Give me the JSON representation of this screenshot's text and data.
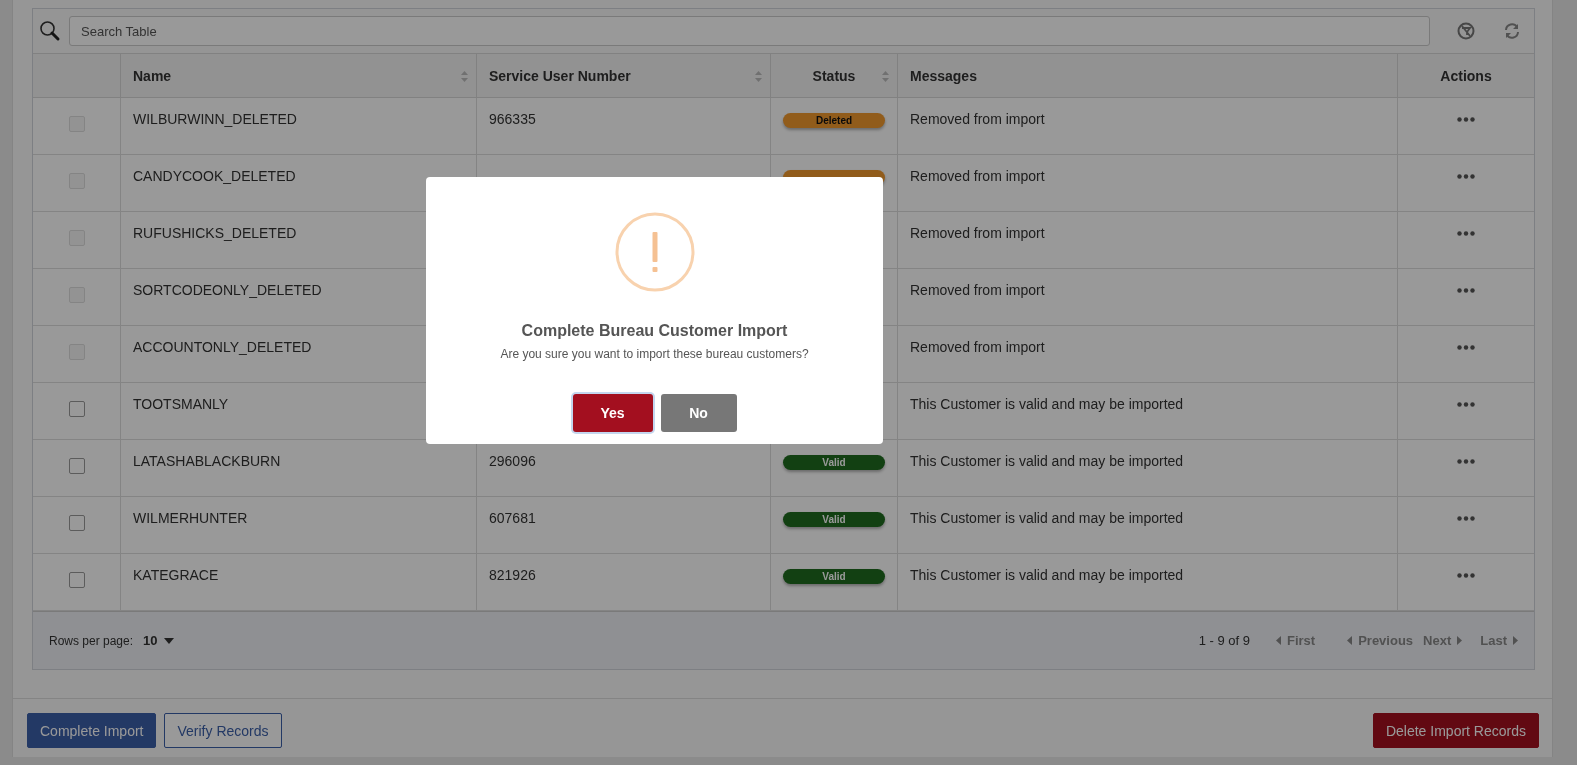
{
  "search": {
    "placeholder": "Search Table"
  },
  "table": {
    "columns": [
      {
        "label": "Name",
        "sortable": true
      },
      {
        "label": "Service User Number",
        "sortable": true
      },
      {
        "label": "Status",
        "sortable": true
      },
      {
        "label": "Messages",
        "sortable": false
      },
      {
        "label": "Actions",
        "sortable": false
      }
    ],
    "rows": [
      {
        "name": "WILBURWINN_DELETED",
        "number": "966335",
        "status": {
          "label": "Deleted",
          "kind": "deleted"
        },
        "message": "Removed from import",
        "checked": false,
        "disabled": true
      },
      {
        "name": "CANDYCOOK_DELETED",
        "status": {
          "kind": "deleted"
        },
        "message": "Removed from import",
        "checked": false,
        "disabled": true
      },
      {
        "name": "RUFUSHICKS_DELETED",
        "message": "Removed from import",
        "checked": false,
        "disabled": true
      },
      {
        "name": "SORTCODEONLY_DELETED",
        "message": "Removed from import",
        "checked": false,
        "disabled": true
      },
      {
        "name": "ACCOUNTONLY_DELETED",
        "message": "Removed from import",
        "checked": false,
        "disabled": true
      },
      {
        "name": "TOOTSMANLY",
        "message": "This Customer is valid and may be imported",
        "checked": false,
        "disabled": false
      },
      {
        "name": "LATASHABLACKBURN",
        "number": "296096",
        "status": {
          "label": "Valid",
          "kind": "valid"
        },
        "message": "This Customer is valid and may be imported",
        "checked": false,
        "disabled": false
      },
      {
        "name": "WILMERHUNTER",
        "number": "607681",
        "status": {
          "label": "Valid",
          "kind": "valid"
        },
        "message": "This Customer is valid and may be imported",
        "checked": false,
        "disabled": false
      },
      {
        "name": "KATEGRACE",
        "number": "821926",
        "status": {
          "label": "Valid",
          "kind": "valid"
        },
        "message": "This Customer is valid and may be imported",
        "checked": false,
        "disabled": false
      }
    ]
  },
  "pagination": {
    "rows_per_page_label": "Rows per page:",
    "rows_per_page": "10",
    "range": "1 - 9 of 9",
    "first": "First",
    "previous": "Previous",
    "next": "Next",
    "last": "Last"
  },
  "buttons": [
    {
      "label": "Complete Import",
      "kind": "primary"
    },
    {
      "label": "Verify Records",
      "kind": "outline"
    },
    {
      "label": "Delete Import Records",
      "kind": "danger"
    }
  ],
  "dialog": {
    "title": "Complete Bureau Customer Import",
    "message": "Are you sure you want to import these bureau customers?",
    "buttons": [
      {
        "label": "Yes",
        "kind": "confirm",
        "focused": true
      },
      {
        "label": "No",
        "kind": "cancel",
        "focused": false
      }
    ]
  }
}
